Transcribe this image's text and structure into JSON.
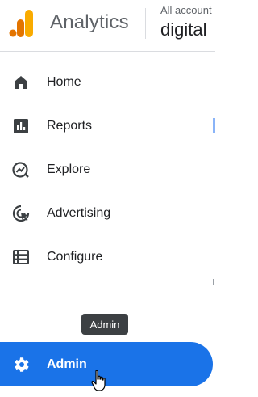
{
  "header": {
    "brand": "Analytics",
    "account_label": "All account",
    "account_name": "digital"
  },
  "nav": {
    "items": [
      {
        "label": "Home",
        "icon": "home-icon"
      },
      {
        "label": "Reports",
        "icon": "reports-icon"
      },
      {
        "label": "Explore",
        "icon": "explore-icon"
      },
      {
        "label": "Advertising",
        "icon": "advertising-icon"
      },
      {
        "label": "Configure",
        "icon": "configure-icon"
      }
    ],
    "admin": {
      "label": "Admin",
      "icon": "gear-icon"
    }
  },
  "tooltip": {
    "text": "Admin"
  },
  "colors": {
    "accent": "#1a73e8",
    "logo_orange": "#f9ab00",
    "logo_dark_orange": "#e37400",
    "icon_gray": "#5f6368"
  }
}
